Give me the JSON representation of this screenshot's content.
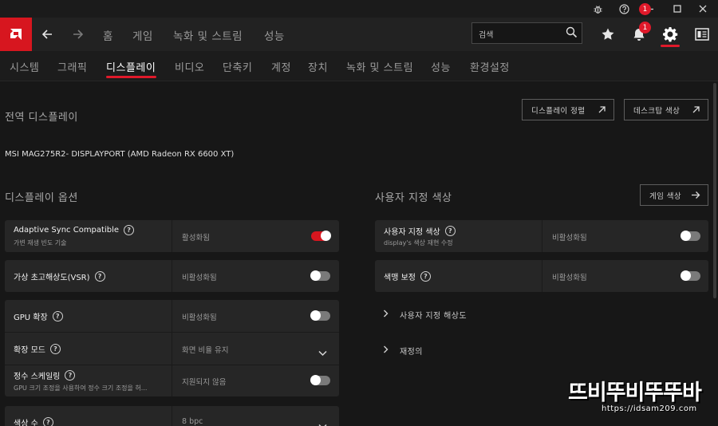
{
  "window": {
    "controls": [
      "bug-icon",
      "help-icon",
      "minimize-icon",
      "maximize-icon",
      "close-icon"
    ]
  },
  "topnav": {
    "links": [
      "홈",
      "게임",
      "녹화 및 스트림",
      "성능"
    ],
    "search_placeholder": "검색",
    "notification_count": "1"
  },
  "subnav": {
    "tabs": [
      "시스템",
      "그래픽",
      "디스플레이",
      "비디오",
      "단축키",
      "계정",
      "장치",
      "녹화 및 스트림",
      "성능",
      "환경설정"
    ],
    "active": "디스플레이"
  },
  "global": {
    "title": "전역 디스플레이",
    "btn_align": "디스플레이 정렬",
    "btn_desktop_color": "데스크탑 색상",
    "monitor": "MSI MAG275R2- DISPLAYPORT (AMD Radeon RX 6600 XT)"
  },
  "display_options": {
    "title": "디스플레이 옵션",
    "adaptive": {
      "label": "Adaptive Sync Compatible",
      "sub": "가변 재생 빈도 기술",
      "value": "활성화됨",
      "on": true
    },
    "vsr": {
      "label": "가상 초고해상도(VSR)",
      "value": "비활성화됨",
      "on": false
    },
    "gpu_scaling": {
      "label": "GPU 확장",
      "value": "비활성화됨",
      "on": false
    },
    "scaling_mode": {
      "label": "확장 모드",
      "value": "화면 비율 유지"
    },
    "integer_scaling": {
      "label": "정수 스케일링",
      "sub": "GPU 크기 조정을 사용하여 정수 크기 조정을 허...",
      "value": "지원되지 않음",
      "on": false
    },
    "color_depth": {
      "label": "색상 수",
      "value": "8 bpc"
    }
  },
  "custom_color": {
    "title": "사용자 지정 색상",
    "btn_game_color": "게임 색상",
    "custom": {
      "label": "사용자 지정 색상",
      "sub": "display's 색상 재현 수정",
      "value": "비활성화됨",
      "on": false
    },
    "temperature": {
      "label": "색맹 보정",
      "value": "비활성화됨",
      "on": false
    },
    "expander_resolution": "사용자 지정 해상도",
    "expander_override": "재정의"
  },
  "watermark": {
    "big": "뜨비뚜비뚜뚜바",
    "url": "https://idsam209.com"
  },
  "colors": {
    "accent": "#e0192a",
    "logo_bg": "#d7161f"
  }
}
